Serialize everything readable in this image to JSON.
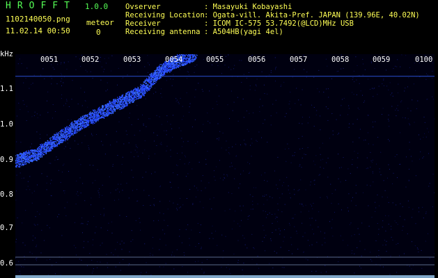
{
  "header": {
    "app_name": "HROFFT",
    "version": "1.0.0",
    "filename": "1102140050.png",
    "datetime": "11.02.14 00:50",
    "meteor_label": "meteor",
    "meteor_count": "0",
    "colors": {
      "app": "#55ff55",
      "text": "#ffff55",
      "info": "#ffffff"
    }
  },
  "info": [
    {
      "label": "Ovserver",
      "value": ": Masayuki Kobayashi"
    },
    {
      "label": "Receiving Location",
      "value": ": Ogata-vill. Akita-Pref. JAPAN (139.96E, 40.02N)"
    },
    {
      "label": "Receiver",
      "value": ": ICOM IC-575 53.7492(@LCD)MHz USB"
    },
    {
      "label": "Receiving antenna",
      "value": ": A504HB(yagi 4el)"
    }
  ],
  "plot": {
    "unit_label": "kHz",
    "y_ticks": [
      "1.1",
      "1.0",
      "0.9",
      "0.8",
      "0.7",
      "0.6"
    ],
    "y_range": [
      0.58,
      1.18
    ],
    "x_ticks": [
      "0051",
      "0052",
      "0053",
      "0054",
      "0055",
      "0056",
      "0057",
      "0058",
      "0059",
      "0100"
    ],
    "trace": [
      [
        0,
        0.89
      ],
      [
        0.5,
        0.91
      ],
      [
        1.0,
        0.95
      ],
      [
        1.5,
        0.99
      ],
      [
        2.0,
        1.02
      ],
      [
        2.5,
        1.05
      ],
      [
        3.0,
        1.08
      ],
      [
        3.4,
        1.13
      ],
      [
        3.8,
        1.16
      ],
      [
        4.3,
        1.18
      ]
    ],
    "carrier_khz": 1.12,
    "colors": {
      "bg": "#000000",
      "signal": "#3b5bff",
      "line": "#1f3fbf"
    }
  }
}
